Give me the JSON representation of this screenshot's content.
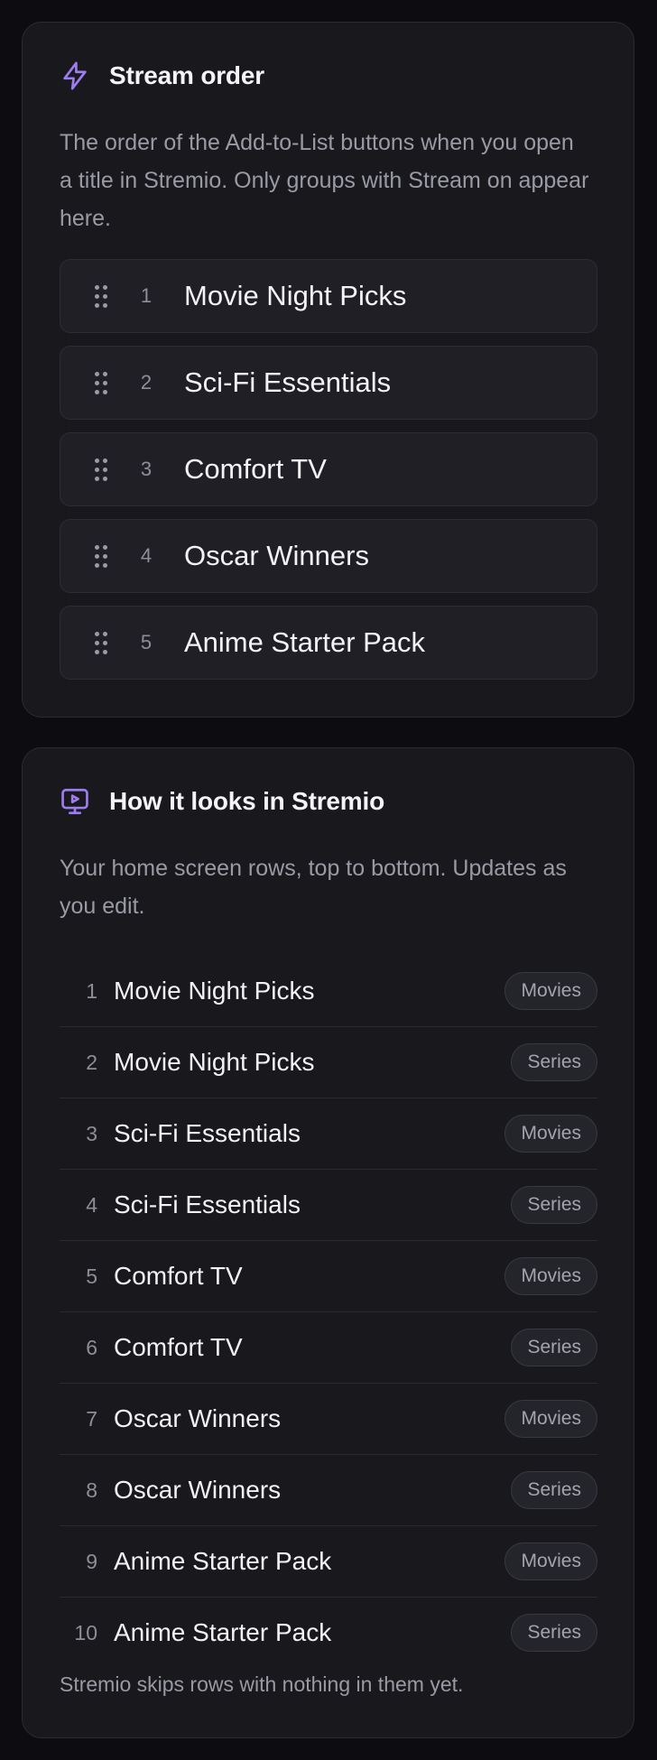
{
  "colors": {
    "accent": "#9d7cf0",
    "card_bg": "#18181d",
    "page_bg": "#0d0d11"
  },
  "stream_order": {
    "icon": "lightning-bolt-icon",
    "title": "Stream order",
    "description": "The order of the Add-to-List buttons when you open a title in Stremio. Only groups with Stream on appear here.",
    "items": [
      {
        "number": "1",
        "name": "Movie Night Picks"
      },
      {
        "number": "2",
        "name": "Sci-Fi Essentials"
      },
      {
        "number": "3",
        "name": "Comfort TV"
      },
      {
        "number": "4",
        "name": "Oscar Winners"
      },
      {
        "number": "5",
        "name": "Anime Starter Pack"
      }
    ]
  },
  "preview": {
    "icon": "tv-play-icon",
    "title": "How it looks in Stremio",
    "description": "Your home screen rows, top to bottom. Updates as you edit.",
    "rows": [
      {
        "number": "1",
        "name": "Movie Night Picks",
        "type": "Movies"
      },
      {
        "number": "2",
        "name": "Movie Night Picks",
        "type": "Series"
      },
      {
        "number": "3",
        "name": "Sci-Fi Essentials",
        "type": "Movies"
      },
      {
        "number": "4",
        "name": "Sci-Fi Essentials",
        "type": "Series"
      },
      {
        "number": "5",
        "name": "Comfort TV",
        "type": "Movies"
      },
      {
        "number": "6",
        "name": "Comfort TV",
        "type": "Series"
      },
      {
        "number": "7",
        "name": "Oscar Winners",
        "type": "Movies"
      },
      {
        "number": "8",
        "name": "Oscar Winners",
        "type": "Series"
      },
      {
        "number": "9",
        "name": "Anime Starter Pack",
        "type": "Movies"
      },
      {
        "number": "10",
        "name": "Anime Starter Pack",
        "type": "Series"
      }
    ],
    "footer": "Stremio skips rows with nothing in them yet."
  }
}
